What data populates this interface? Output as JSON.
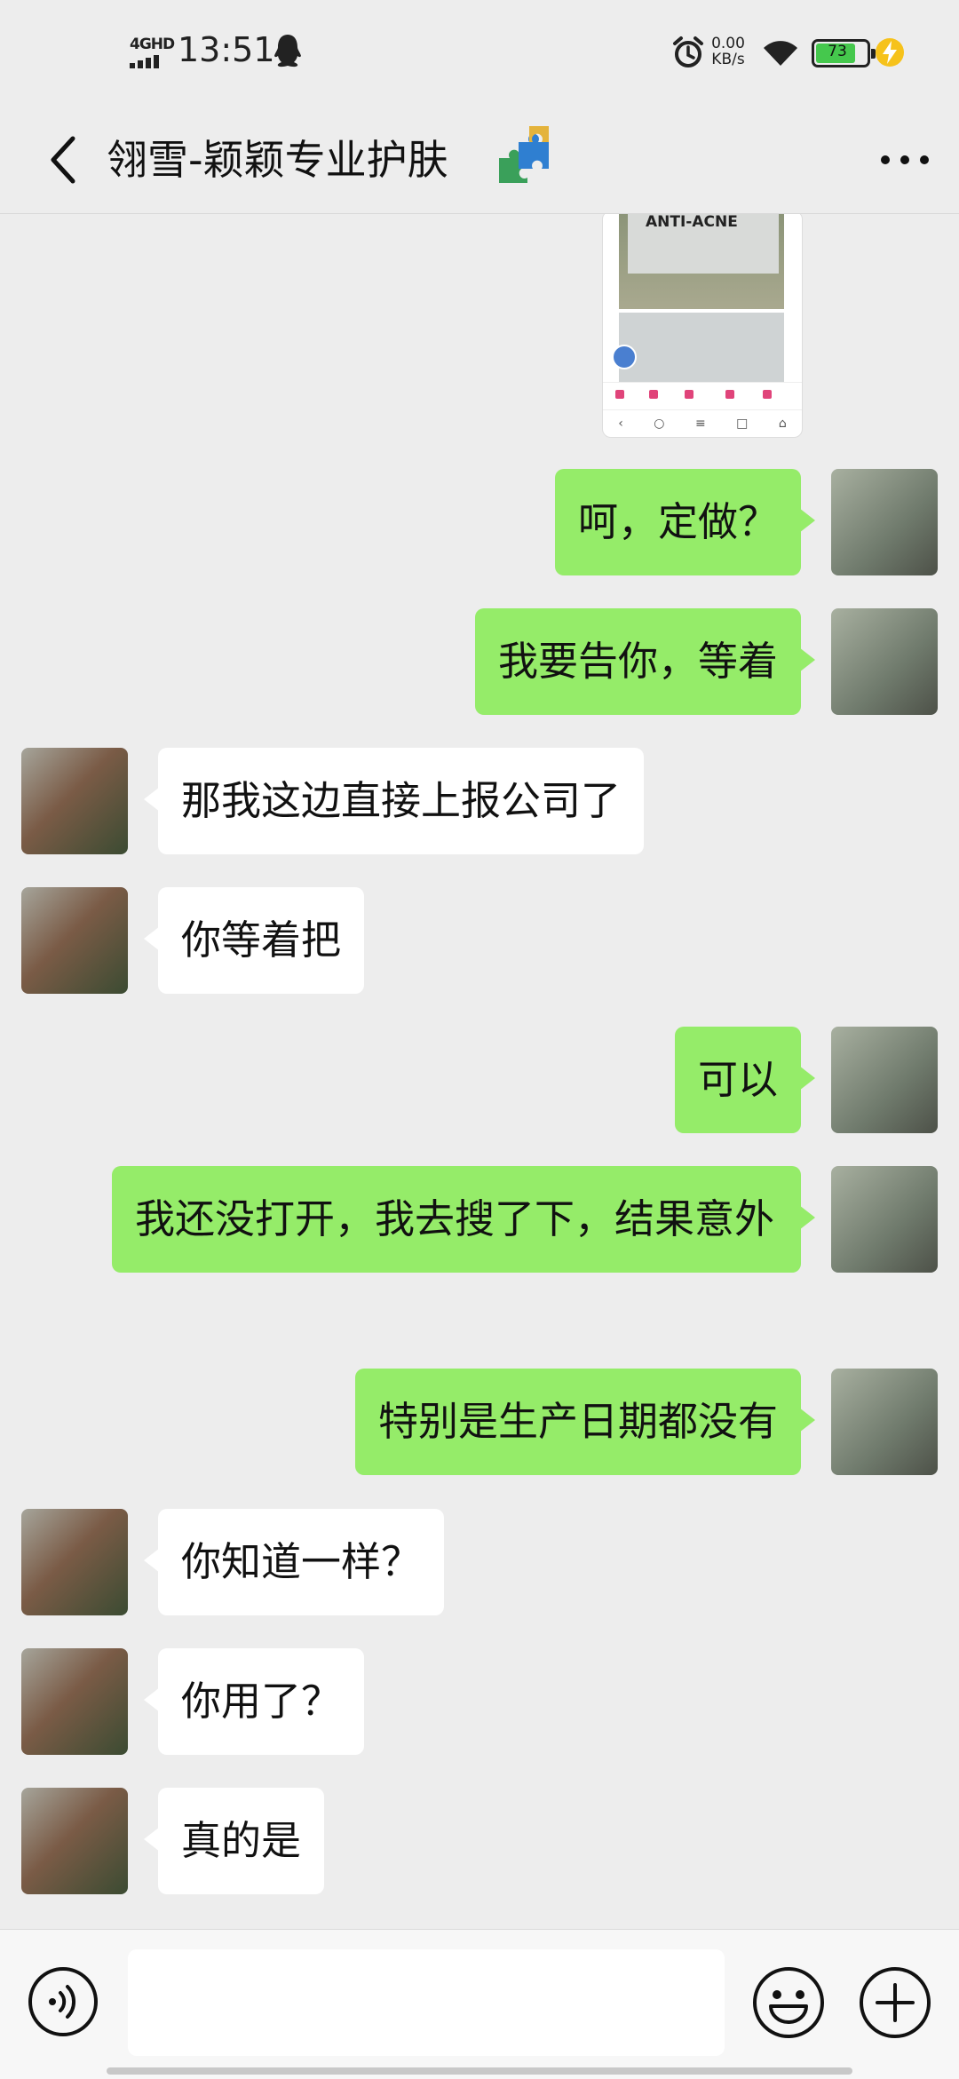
{
  "status_bar": {
    "network": "4GHD",
    "time": "13:51",
    "speed_value": "0.00",
    "speed_unit": "KB/s",
    "battery": "73"
  },
  "header": {
    "title": "翎雪-颖颖专业护肤",
    "title_emoji": "puzzle-piece-icon"
  },
  "image_message": {
    "brand_text": "ANTI-ACNE"
  },
  "messages": [
    {
      "from": "me",
      "text": "呵，定做？"
    },
    {
      "from": "me",
      "text": "我要告你，等着"
    },
    {
      "from": "them",
      "text": "那我这边直接上报公司了"
    },
    {
      "from": "them",
      "text": "你等着把"
    },
    {
      "from": "me",
      "text": "可以"
    },
    {
      "from": "me",
      "text": "我还没打开，我去搜了下，结果意外"
    },
    {
      "from": "me",
      "text": "特别是生产日期都没有"
    },
    {
      "from": "them",
      "text": "你知道一样？"
    },
    {
      "from": "them",
      "text": "你用了？"
    },
    {
      "from": "them",
      "text": "真的是"
    }
  ],
  "input_bar": {
    "value": "",
    "placeholder": ""
  },
  "colors": {
    "background": "#ededed",
    "my_bubble": "#95ec69",
    "their_bubble": "#ffffff",
    "battery_fill": "#45c84d"
  }
}
